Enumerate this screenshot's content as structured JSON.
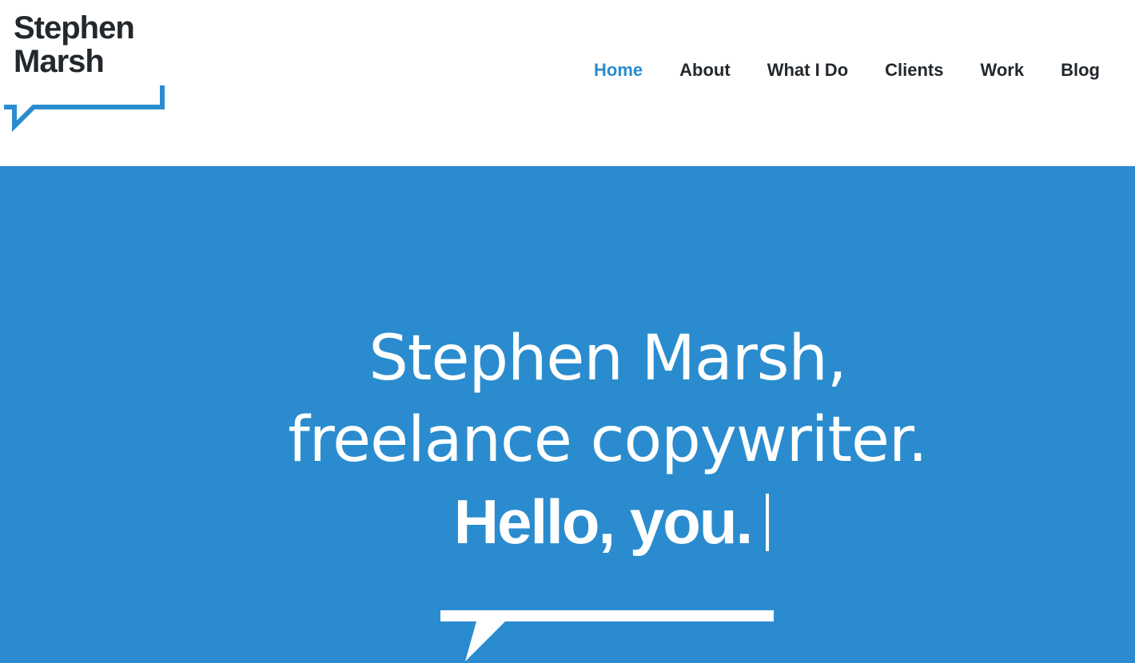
{
  "brand": {
    "name_line1": "Stephen",
    "name_line2": "Marsh",
    "accent_color": "#2a8ccf",
    "text_color": "#23282d",
    "logo_icon": "speech-bubble-icon"
  },
  "nav": {
    "items": [
      {
        "label": "Home",
        "active": true
      },
      {
        "label": "About",
        "active": false
      },
      {
        "label": "What I Do",
        "active": false
      },
      {
        "label": "Clients",
        "active": false
      },
      {
        "label": "Work",
        "active": false
      },
      {
        "label": "Blog",
        "active": false
      }
    ]
  },
  "hero": {
    "background_color": "#2a8ccf",
    "headline_line1": "Stephen Marsh,",
    "headline_line2": "freelance copywriter.",
    "typed_text": "Hello, you.",
    "decoration_icon": "speech-bubble-icon"
  }
}
